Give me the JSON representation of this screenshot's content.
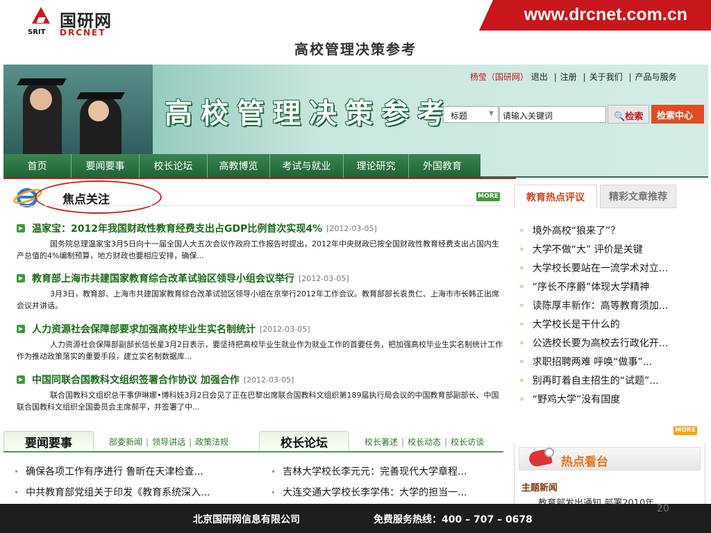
{
  "header": {
    "logo_cn": "国研网",
    "logo_srit": "SRIT",
    "logo_en": "DRCNET",
    "url": "www.drcnet.com.cn",
    "slide_title": "高校管理决策参考"
  },
  "banner": {
    "title": "高校管理决策参考",
    "user": "杨莹（国研网）",
    "logout": "退出",
    "register": "注册",
    "about": "关于我们",
    "products": "产品与服务",
    "search_field": "标题",
    "search_input": "请输入关键词",
    "search_btn": "检索",
    "search_center": "检索中心"
  },
  "nav": [
    "首页",
    "要闻要事",
    "校长论坛",
    "高教博览",
    "考试与就业",
    "理论研究",
    "外国教育"
  ],
  "focus": {
    "title": "焦点关注",
    "more": "MORE",
    "items": [
      {
        "title": "温家宝：2012年我国财政性教育经费支出占GDP比例首次实现4%",
        "date": "[2012-03-05]",
        "summary": "国务院总理温家宝3月5日向十一届全国人大五次会议作政府工作报告时提出，2012年中央财政已按全国财政性教育经费支出占国内生产总值的4%编制预算，地方财政也要相应安排，确保..."
      },
      {
        "title": "教育部上海市共建国家教育综合改革试验区领导小组会议举行",
        "date": "[2012-03-05]",
        "summary": "3月3日，教育部、上海市共建国家教育综合改革试验区领导小组在京举行2012年工作会议。教育部部长袁贵仁、上海市市长韩正出席会议并讲话。"
      },
      {
        "title": "人力资源社会保障部要求加强高校毕业生实名制统计",
        "date": "[2012-03-05]",
        "summary": "人力资源社会保障部副部长信长星3月2日表示，要坚持把高校毕业生就业作为就业工作的首要任务，把加强高校毕业生实名制统计工作作为推动政策落实的重要手段，建立实名制数据库..."
      },
      {
        "title": "中国同联合国教科文组织签署合作协议 加强合作",
        "date": "[2012-03-05]",
        "summary": "联合国教科文组织总干事伊琳娜•博科娃3月2日会见了正在巴黎出席联合国教科文组织第189届执行局会议的中国教育部副部长、中国联合国教科文组织全国委员会主席郝平，并签署了中..."
      }
    ]
  },
  "right_tabs": {
    "active": "教育热点评议",
    "inactive": "精彩文章推荐",
    "more": "MORE",
    "items": [
      "境外高校“狼来了”？",
      "大学不做“大” 评价是关键",
      "大学校长要站在一流学术对立...",
      "“序长不序爵”体现大学精神",
      "读陈厚丰新作：高等教育须加...",
      "大学校长是干什么的",
      "公选校长要为高校去行政化开...",
      "求职招聘两难 呼唤“做事”...",
      "别再盯着自主招生的“试题”...",
      "“野鸡大学”没有国度"
    ]
  },
  "section_news": {
    "title": "要闻要事",
    "links": [
      "部委新闻",
      "领导讲话",
      "政策法规"
    ],
    "items": [
      "确保各项工作有序进行 鲁昕在天津检查...",
      "中共教育部党组关于印发《教育系统深入..."
    ]
  },
  "section_forum": {
    "title": "校长论坛",
    "links": [
      "校长著述",
      "校长动态",
      "校长访谈"
    ],
    "items": [
      "吉林大学校长李元元：完善现代大学章程...",
      "大连交通大学校长李学伟：大学的担当一..."
    ]
  },
  "hot": {
    "title": "热点看台",
    "subtitle": "主题新闻",
    "clipped_item": "教育部发出通知 部署2010年"
  },
  "footer": {
    "company": "北京国研网信息有限公司",
    "hotline": "免费服务热线：400 – 707 – 0678",
    "page": "20"
  },
  "colors": {
    "brand_red": "#c8161d",
    "nav_green": "#1e6335",
    "accent_orange": "#e34b22",
    "news_green": "#1a6b1a"
  }
}
